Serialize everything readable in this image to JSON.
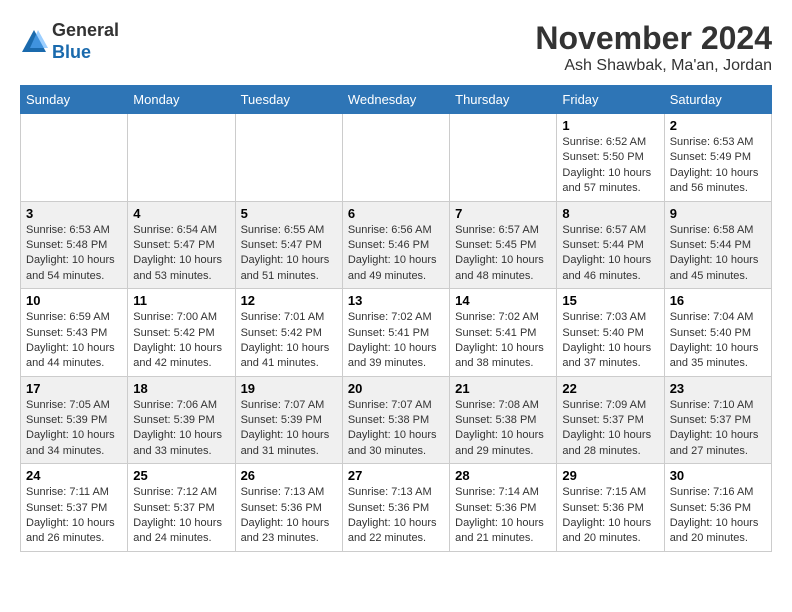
{
  "logo": {
    "general": "General",
    "blue": "Blue"
  },
  "header": {
    "month": "November 2024",
    "location": "Ash Shawbak, Ma'an, Jordan"
  },
  "weekdays": [
    "Sunday",
    "Monday",
    "Tuesday",
    "Wednesday",
    "Thursday",
    "Friday",
    "Saturday"
  ],
  "weeks": [
    [
      {
        "day": "",
        "info": ""
      },
      {
        "day": "",
        "info": ""
      },
      {
        "day": "",
        "info": ""
      },
      {
        "day": "",
        "info": ""
      },
      {
        "day": "",
        "info": ""
      },
      {
        "day": "1",
        "info": "Sunrise: 6:52 AM\nSunset: 5:50 PM\nDaylight: 10 hours and 57 minutes."
      },
      {
        "day": "2",
        "info": "Sunrise: 6:53 AM\nSunset: 5:49 PM\nDaylight: 10 hours and 56 minutes."
      }
    ],
    [
      {
        "day": "3",
        "info": "Sunrise: 6:53 AM\nSunset: 5:48 PM\nDaylight: 10 hours and 54 minutes."
      },
      {
        "day": "4",
        "info": "Sunrise: 6:54 AM\nSunset: 5:47 PM\nDaylight: 10 hours and 53 minutes."
      },
      {
        "day": "5",
        "info": "Sunrise: 6:55 AM\nSunset: 5:47 PM\nDaylight: 10 hours and 51 minutes."
      },
      {
        "day": "6",
        "info": "Sunrise: 6:56 AM\nSunset: 5:46 PM\nDaylight: 10 hours and 49 minutes."
      },
      {
        "day": "7",
        "info": "Sunrise: 6:57 AM\nSunset: 5:45 PM\nDaylight: 10 hours and 48 minutes."
      },
      {
        "day": "8",
        "info": "Sunrise: 6:57 AM\nSunset: 5:44 PM\nDaylight: 10 hours and 46 minutes."
      },
      {
        "day": "9",
        "info": "Sunrise: 6:58 AM\nSunset: 5:44 PM\nDaylight: 10 hours and 45 minutes."
      }
    ],
    [
      {
        "day": "10",
        "info": "Sunrise: 6:59 AM\nSunset: 5:43 PM\nDaylight: 10 hours and 44 minutes."
      },
      {
        "day": "11",
        "info": "Sunrise: 7:00 AM\nSunset: 5:42 PM\nDaylight: 10 hours and 42 minutes."
      },
      {
        "day": "12",
        "info": "Sunrise: 7:01 AM\nSunset: 5:42 PM\nDaylight: 10 hours and 41 minutes."
      },
      {
        "day": "13",
        "info": "Sunrise: 7:02 AM\nSunset: 5:41 PM\nDaylight: 10 hours and 39 minutes."
      },
      {
        "day": "14",
        "info": "Sunrise: 7:02 AM\nSunset: 5:41 PM\nDaylight: 10 hours and 38 minutes."
      },
      {
        "day": "15",
        "info": "Sunrise: 7:03 AM\nSunset: 5:40 PM\nDaylight: 10 hours and 37 minutes."
      },
      {
        "day": "16",
        "info": "Sunrise: 7:04 AM\nSunset: 5:40 PM\nDaylight: 10 hours and 35 minutes."
      }
    ],
    [
      {
        "day": "17",
        "info": "Sunrise: 7:05 AM\nSunset: 5:39 PM\nDaylight: 10 hours and 34 minutes."
      },
      {
        "day": "18",
        "info": "Sunrise: 7:06 AM\nSunset: 5:39 PM\nDaylight: 10 hours and 33 minutes."
      },
      {
        "day": "19",
        "info": "Sunrise: 7:07 AM\nSunset: 5:39 PM\nDaylight: 10 hours and 31 minutes."
      },
      {
        "day": "20",
        "info": "Sunrise: 7:07 AM\nSunset: 5:38 PM\nDaylight: 10 hours and 30 minutes."
      },
      {
        "day": "21",
        "info": "Sunrise: 7:08 AM\nSunset: 5:38 PM\nDaylight: 10 hours and 29 minutes."
      },
      {
        "day": "22",
        "info": "Sunrise: 7:09 AM\nSunset: 5:37 PM\nDaylight: 10 hours and 28 minutes."
      },
      {
        "day": "23",
        "info": "Sunrise: 7:10 AM\nSunset: 5:37 PM\nDaylight: 10 hours and 27 minutes."
      }
    ],
    [
      {
        "day": "24",
        "info": "Sunrise: 7:11 AM\nSunset: 5:37 PM\nDaylight: 10 hours and 26 minutes."
      },
      {
        "day": "25",
        "info": "Sunrise: 7:12 AM\nSunset: 5:37 PM\nDaylight: 10 hours and 24 minutes."
      },
      {
        "day": "26",
        "info": "Sunrise: 7:13 AM\nSunset: 5:36 PM\nDaylight: 10 hours and 23 minutes."
      },
      {
        "day": "27",
        "info": "Sunrise: 7:13 AM\nSunset: 5:36 PM\nDaylight: 10 hours and 22 minutes."
      },
      {
        "day": "28",
        "info": "Sunrise: 7:14 AM\nSunset: 5:36 PM\nDaylight: 10 hours and 21 minutes."
      },
      {
        "day": "29",
        "info": "Sunrise: 7:15 AM\nSunset: 5:36 PM\nDaylight: 10 hours and 20 minutes."
      },
      {
        "day": "30",
        "info": "Sunrise: 7:16 AM\nSunset: 5:36 PM\nDaylight: 10 hours and 20 minutes."
      }
    ]
  ]
}
